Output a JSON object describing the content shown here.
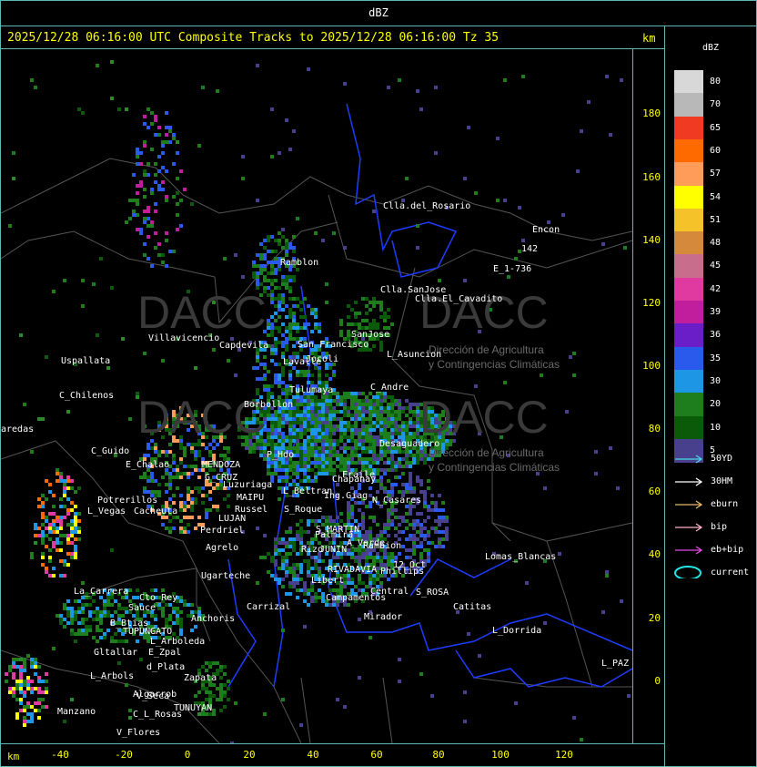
{
  "top_title": "dBZ",
  "header": {
    "text": "2025/12/28 06:16:00 UTC Composite Tracks to 2025/12/28 06:16:00 Tz 35",
    "unit": "km"
  },
  "y_axis": {
    "unit": "km",
    "ticks": [
      "180",
      "160",
      "140",
      "120",
      "100",
      "80",
      "60",
      "40",
      "20",
      "0"
    ]
  },
  "x_axis": {
    "unit": "km",
    "ticks": [
      "-40",
      "-20",
      "0",
      "20",
      "40",
      "60",
      "80",
      "100",
      "120"
    ]
  },
  "legend": {
    "title": "dBZ",
    "scale": [
      {
        "label": "80",
        "color": "#d8d8d8"
      },
      {
        "label": "70",
        "color": "#b8b8b8"
      },
      {
        "label": "65",
        "color": "#f03a22"
      },
      {
        "label": "60",
        "color": "#ff6a00"
      },
      {
        "label": "57",
        "color": "#ff9c5a"
      },
      {
        "label": "54",
        "color": "#ffff00"
      },
      {
        "label": "51",
        "color": "#f6c22a"
      },
      {
        "label": "48",
        "color": "#d48a3a"
      },
      {
        "label": "45",
        "color": "#c86e8c"
      },
      {
        "label": "42",
        "color": "#e03aa0"
      },
      {
        "label": "39",
        "color": "#c01e9c"
      },
      {
        "label": "36",
        "color": "#6a1ec8"
      },
      {
        "label": "35",
        "color": "#2a5aec"
      },
      {
        "label": "30",
        "color": "#1e96e6"
      },
      {
        "label": "20",
        "color": "#1e7e1e"
      },
      {
        "label": "10",
        "color": "#0a5a0a"
      },
      {
        "label": "5",
        "color": "#48408c"
      }
    ],
    "tracks": [
      {
        "label": "50YD",
        "color": "#4ad6e6"
      },
      {
        "label": "30HM",
        "color": "#ffffff"
      },
      {
        "label": "eburn",
        "color": "#e6b86a"
      },
      {
        "label": "bip",
        "color": "#ffb0c8"
      },
      {
        "label": "eb+bip",
        "color": "#e64ae6"
      },
      {
        "label": "current",
        "color": "#22e6e6"
      }
    ]
  },
  "watermark": {
    "name": "DACC",
    "line1": "Dirección de Agricultura",
    "line2": "y Contingencias Climáticas"
  },
  "places": [
    {
      "name": "Clla.del_Rosario"
    },
    {
      "name": "Encon"
    },
    {
      "name": "142"
    },
    {
      "name": "E_1-736"
    },
    {
      "name": "Ramblon"
    },
    {
      "name": "Clla.SanJose"
    },
    {
      "name": "Clla.El_Cavadito"
    },
    {
      "name": "SanJose"
    },
    {
      "name": "L_Asuncion"
    },
    {
      "name": "San Francisco"
    },
    {
      "name": "Villavicencio"
    },
    {
      "name": "Uspallata"
    },
    {
      "name": "C_Chilenos"
    },
    {
      "name": "aredas"
    },
    {
      "name": "C_Guido"
    },
    {
      "name": "E_Chalao"
    },
    {
      "name": "MENDOZA"
    },
    {
      "name": "G_CRUZ"
    },
    {
      "name": "Luzuriaga"
    },
    {
      "name": "MAIPU"
    },
    {
      "name": "Russel"
    },
    {
      "name": "LUJAN"
    },
    {
      "name": "Perdriel"
    },
    {
      "name": "Potrerillos"
    },
    {
      "name": "Cacheuta"
    },
    {
      "name": "L_Vegas"
    },
    {
      "name": "Agrelo"
    },
    {
      "name": "Ugarteche"
    },
    {
      "name": "La_Carrera"
    },
    {
      "name": "Cto_Rey"
    },
    {
      "name": "Sauce"
    },
    {
      "name": "B_Btias"
    },
    {
      "name": "TUPUNGATO"
    },
    {
      "name": "Anchoris"
    },
    {
      "name": "L_Arboleda"
    },
    {
      "name": "Gltallar"
    },
    {
      "name": "E_Zpal"
    },
    {
      "name": "d_Plata"
    },
    {
      "name": "L_Arbols"
    },
    {
      "name": "Zapata"
    },
    {
      "name": "Algarrob"
    },
    {
      "name": "V_Seca"
    },
    {
      "name": "Manzano"
    },
    {
      "name": "C_L_Rosas"
    },
    {
      "name": "TUNUYAN"
    },
    {
      "name": "V_Flores"
    },
    {
      "name": "Carrizal"
    },
    {
      "name": "Lavalle"
    },
    {
      "name": "Borbollon"
    },
    {
      "name": "P_Hdo"
    },
    {
      "name": "L_Beltran"
    },
    {
      "name": "Chapanay"
    },
    {
      "name": "S_Roque"
    },
    {
      "name": "N_Casares"
    },
    {
      "name": "S_MARTIN"
    },
    {
      "name": "A_Verde"
    },
    {
      "name": "Rambion"
    },
    {
      "name": "JUNIN"
    },
    {
      "name": "RIVADAVIA"
    },
    {
      "name": "Phillips"
    },
    {
      "name": "12_Oct"
    },
    {
      "name": "S_ROSA"
    },
    {
      "name": "Lomas_Blancas"
    },
    {
      "name": "Central"
    },
    {
      "name": "Campamentos"
    },
    {
      "name": "Libert"
    },
    {
      "name": "Catitas"
    },
    {
      "name": "Mirador"
    },
    {
      "name": "L_Dorrida"
    },
    {
      "name": "L_PAZ"
    },
    {
      "name": "Desaguadero"
    },
    {
      "name": "C_Andre"
    },
    {
      "name": "Jocoli"
    },
    {
      "name": "Tulumaya"
    },
    {
      "name": "Capdevila"
    },
    {
      "name": "Palmira"
    },
    {
      "name": "Ing.Giag"
    },
    {
      "name": "Fraile"
    },
    {
      "name": "Rizo"
    }
  ]
}
